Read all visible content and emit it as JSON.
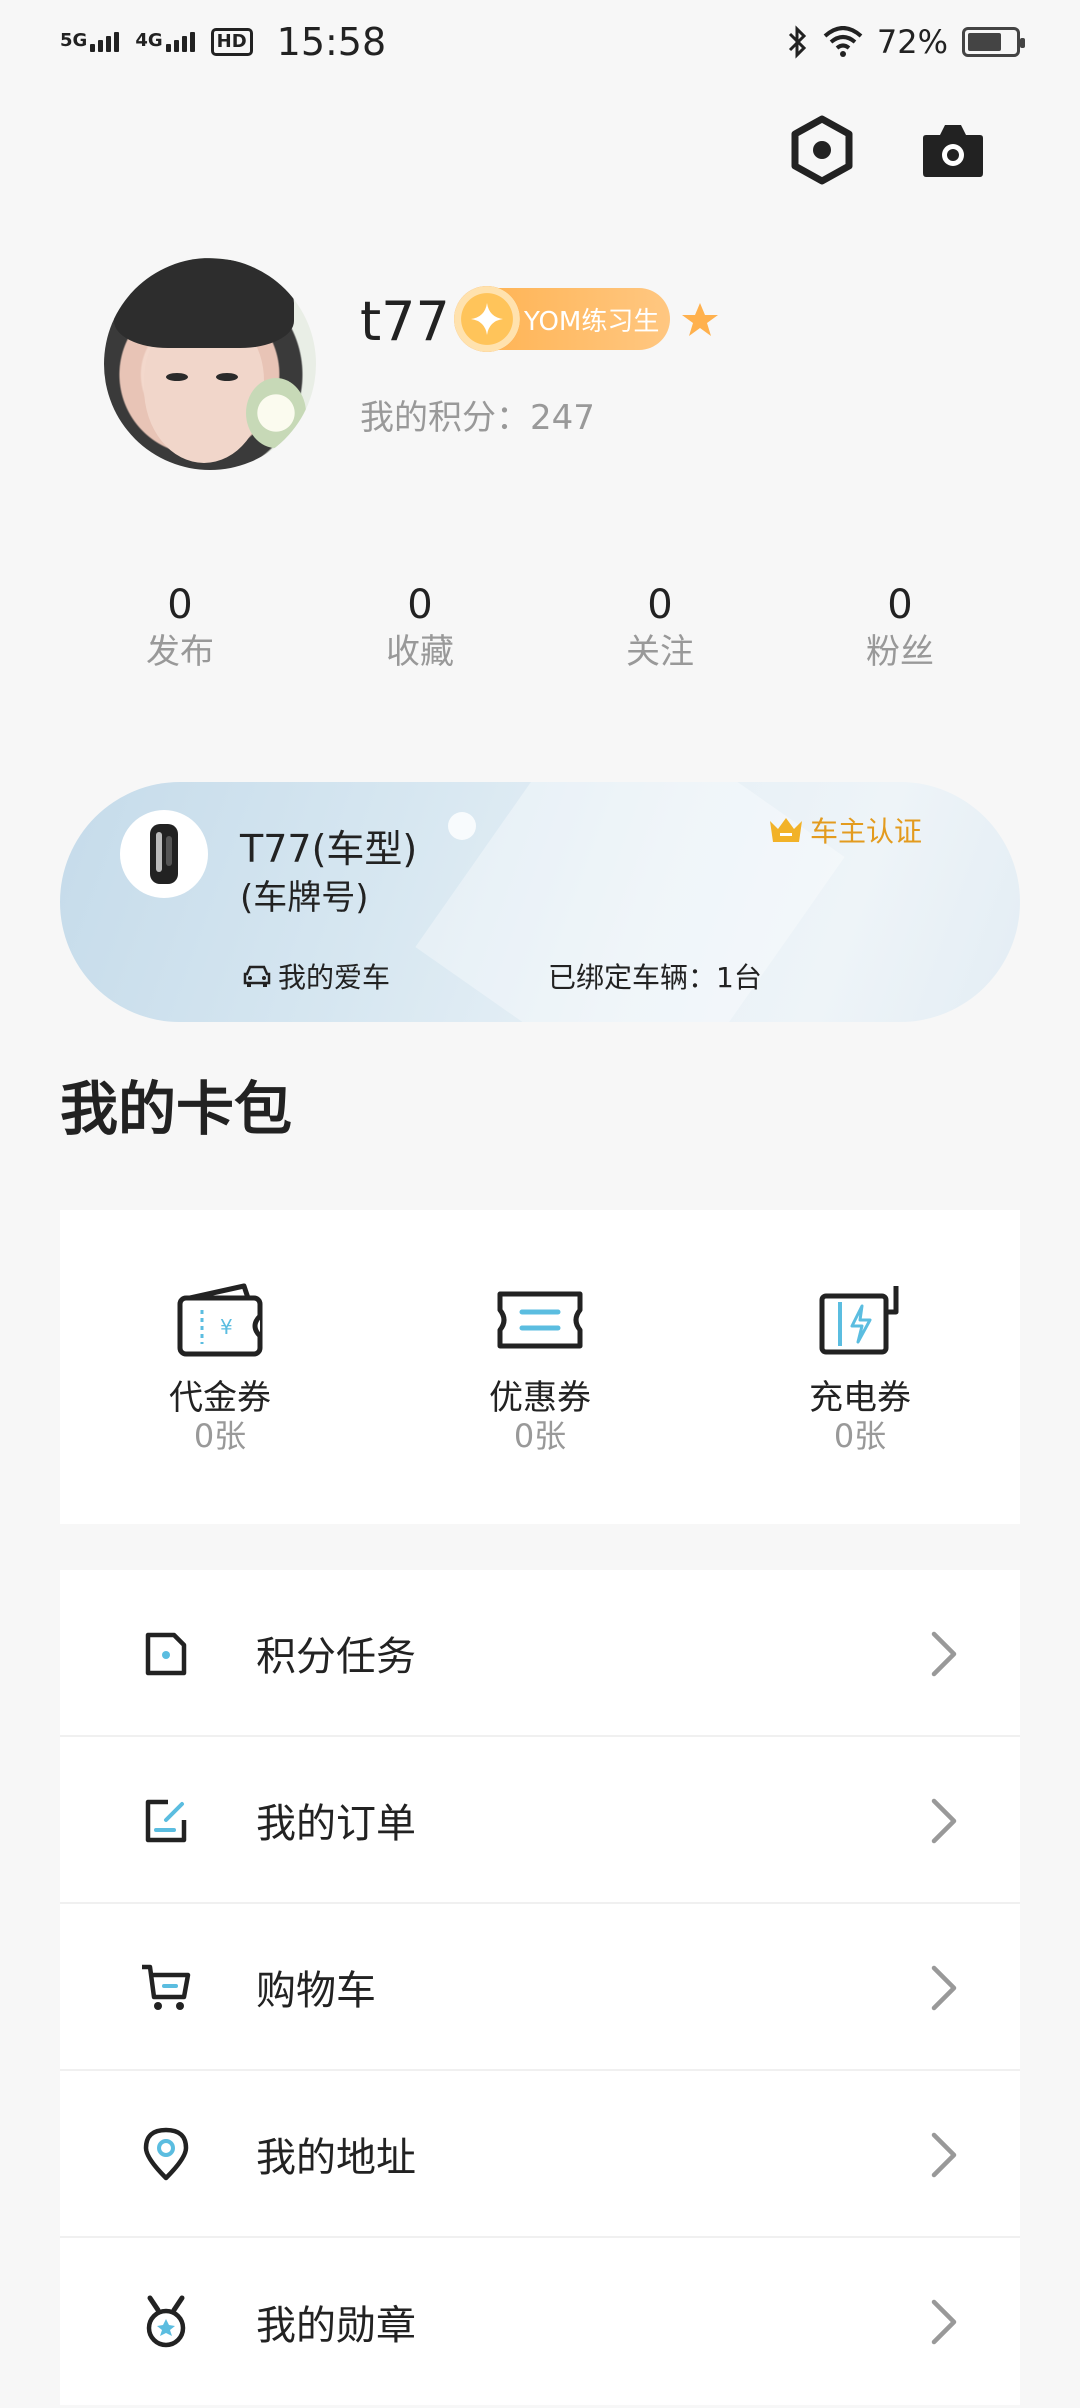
{
  "status_bar": {
    "network1": "5G",
    "network2": "4G",
    "hd": "HD",
    "time": "15:58",
    "battery_percent": "72%",
    "battery_level": 0.72,
    "icons": [
      "bluetooth-icon",
      "wifi-icon",
      "battery-icon"
    ]
  },
  "header": {
    "icons": [
      "settings-hex-icon",
      "camera-icon"
    ]
  },
  "profile": {
    "username": "t77",
    "level_badge": "YOM练习生",
    "points_text": "我的积分：247"
  },
  "stats": [
    {
      "value": "0",
      "label": "发布"
    },
    {
      "value": "0",
      "label": "收藏"
    },
    {
      "value": "0",
      "label": "关注"
    },
    {
      "value": "0",
      "label": "粉丝"
    }
  ],
  "car_card": {
    "model": "T77(车型)",
    "plate": "(车牌号)",
    "owner_cert": "车主认证",
    "my_car": "我的爱车",
    "bound": "已绑定车辆：1台"
  },
  "wallet": {
    "title": "我的卡包",
    "items": [
      {
        "name": "代金券",
        "count": "0张",
        "icon": "voucher-icon"
      },
      {
        "name": "优惠券",
        "count": "0张",
        "icon": "coupon-icon"
      },
      {
        "name": "充电券",
        "count": "0张",
        "icon": "charging-coupon-icon"
      }
    ]
  },
  "menu": {
    "items": [
      {
        "label": "积分任务",
        "icon": "points-task-icon"
      },
      {
        "label": "我的订单",
        "icon": "order-icon"
      },
      {
        "label": "购物车",
        "icon": "cart-icon"
      },
      {
        "label": "我的地址",
        "icon": "location-icon"
      },
      {
        "label": "我的勋章",
        "icon": "medal-icon"
      }
    ]
  },
  "colors": {
    "accent_blue": "#5bbde0",
    "badge_orange": "#ffb14e",
    "cert_gold": "#e39b1e"
  }
}
